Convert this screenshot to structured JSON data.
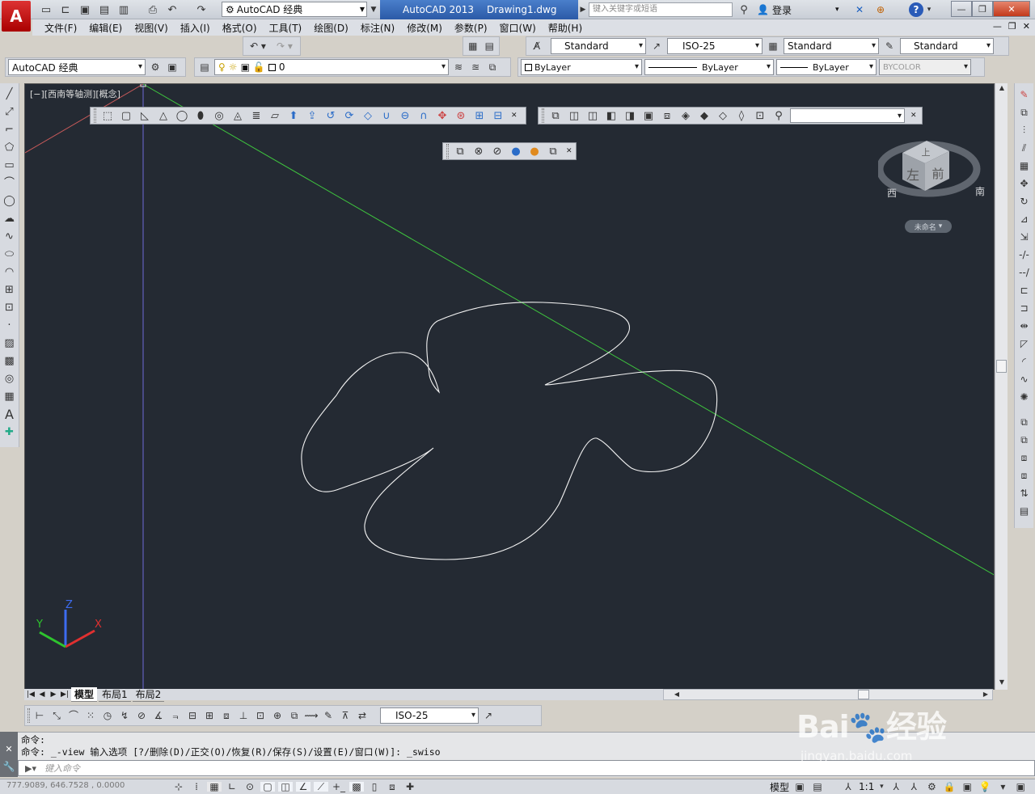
{
  "app": {
    "workspace": "AutoCAD 经典",
    "title_app": "AutoCAD 2013",
    "title_file": "Drawing1.dwg",
    "search_placeholder": "键入关键字或短语",
    "login_label": "登录"
  },
  "menu": [
    "文件(F)",
    "编辑(E)",
    "视图(V)",
    "插入(I)",
    "格式(O)",
    "工具(T)",
    "绘图(D)",
    "标注(N)",
    "修改(M)",
    "参数(P)",
    "窗口(W)",
    "帮助(H)"
  ],
  "styles": {
    "text_style": "Standard",
    "dim_style": "ISO-25",
    "table_style": "Standard",
    "multileader_style": "Standard"
  },
  "layer": {
    "workspace_combo": "AutoCAD 经典",
    "current_layer": "0",
    "color": "ByLayer",
    "linetype": "ByLayer",
    "lineweight": "ByLayer",
    "plotstyle": "BYCOLOR"
  },
  "viewport": {
    "label": "[−][西南等轴测][概念]",
    "bg_color": "#242a33",
    "view_name": "未命名",
    "cube_faces": {
      "top": "上",
      "left": "左",
      "front": "前"
    },
    "compass": {
      "west": "西",
      "south": "南"
    }
  },
  "ucs": {
    "x": "X",
    "y": "Y",
    "z": "Z"
  },
  "layout_tabs": [
    "模型",
    "布局1",
    "布局2"
  ],
  "dim_toolbar": {
    "dim_style": "ISO-25"
  },
  "command": {
    "line1": "命令:",
    "line2": "命令: _-view 输入选项 [?/删除(D)/正交(O)/恢复(R)/保存(S)/设置(E)/窗口(W)]: _swiso",
    "input_placeholder": "键入命令"
  },
  "status": {
    "coords": "777.9089,  646.7528 , 0.0000",
    "model_label": "模型",
    "scale": "1:1"
  }
}
